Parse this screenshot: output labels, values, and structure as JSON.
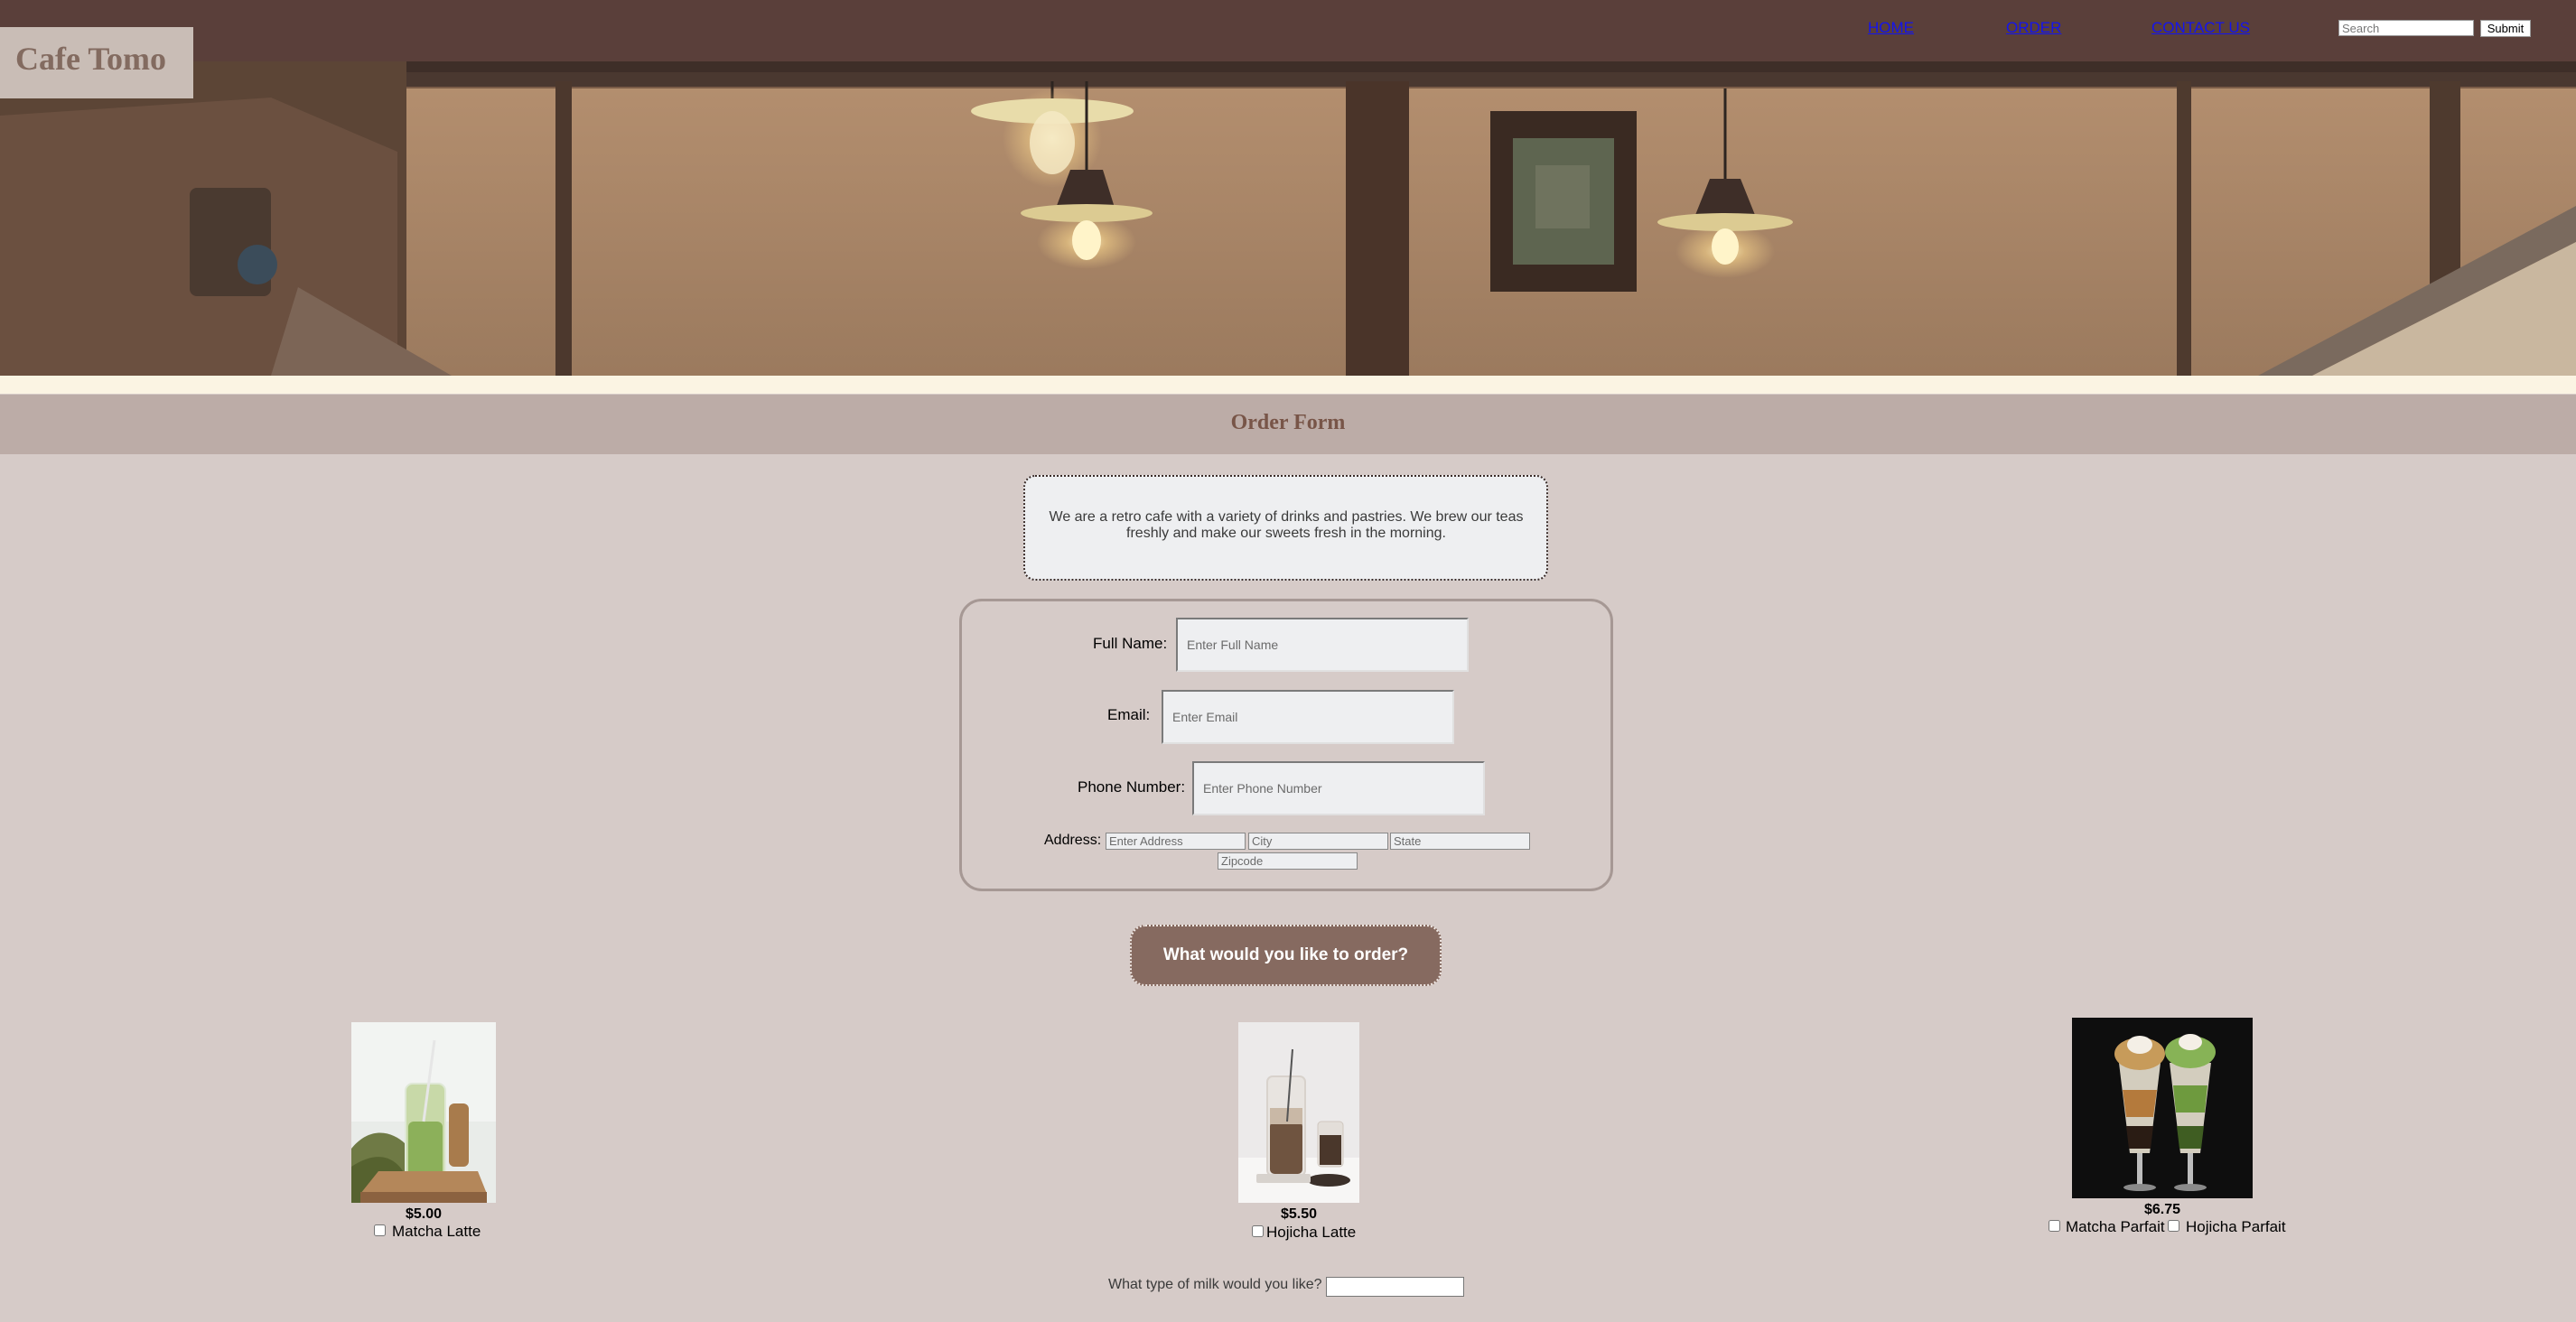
{
  "nav": {
    "home": "HOME",
    "order": "ORDER",
    "contact": "CONTACT US",
    "search_placeholder": "Search",
    "submit_label": "Submit"
  },
  "brand": {
    "name": "Cafe Tomo"
  },
  "form": {
    "title": "Order Form",
    "intro": "We are a retro cafe with a variety of drinks and pastries. We brew our teas freshly and make our sweets fresh in the morning.",
    "full_name_label": "Full Name:",
    "full_name_placeholder": "Enter Full Name",
    "email_label": "Email:",
    "email_placeholder": "Enter Email",
    "phone_label": "Phone Number:",
    "phone_placeholder": "Enter Phone Number",
    "address_label": "Address:",
    "address_placeholder": "Enter Address",
    "city_placeholder": "City",
    "state_placeholder": "State",
    "zip_placeholder": "Zipcode"
  },
  "order": {
    "prompt": "What would you like to order?",
    "products": [
      {
        "price": "$5.00",
        "options": [
          "Matcha Latte"
        ]
      },
      {
        "price": "$5.50",
        "options": [
          "Hojicha Latte"
        ]
      },
      {
        "price": "$6.75",
        "options": [
          "Matcha Parfait",
          "Hojicha Parfait"
        ]
      }
    ],
    "milk_label": "What type of milk would you like?"
  },
  "colors": {
    "nav_bg": "#5a3f3a",
    "page_bg": "#d6cbc8",
    "title_bar": "#bcaca7",
    "accent": "#866a60",
    "link": "#1414ee"
  }
}
